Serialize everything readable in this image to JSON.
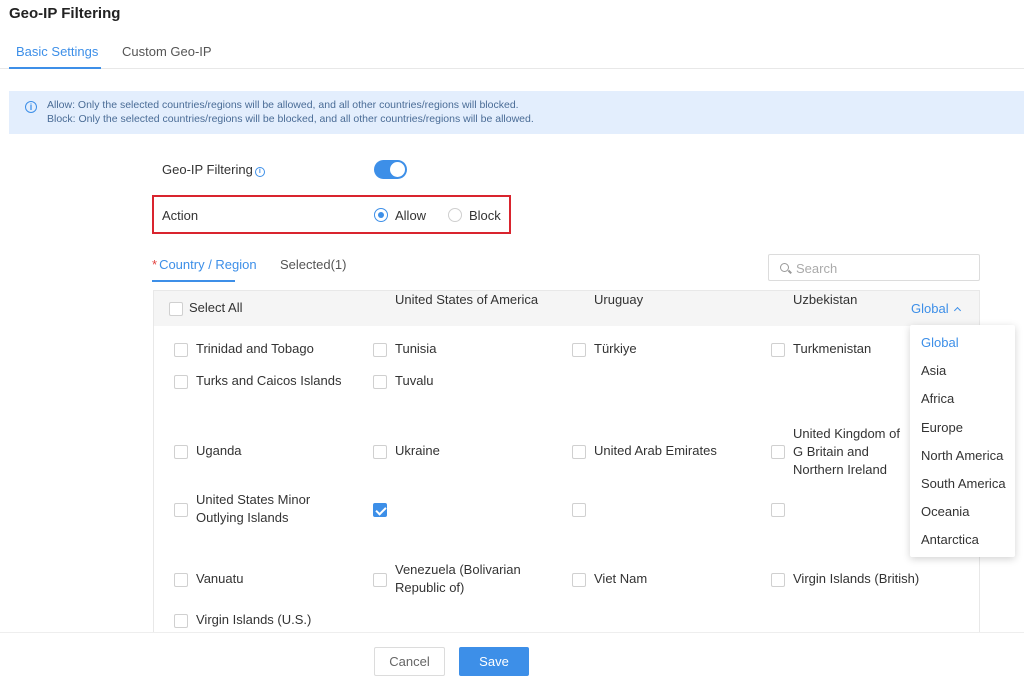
{
  "page": {
    "title": "Geo-IP Filtering"
  },
  "tabs": [
    {
      "label": "Basic Settings"
    },
    {
      "label": "Custom Geo-IP"
    }
  ],
  "info": {
    "line1": "Allow: Only the selected countries/regions will be allowed, and all other countries/regions will blocked.",
    "line2": "Block: Only the selected countries/regions will be blocked, and all other countries/regions will be allowed."
  },
  "form": {
    "geo_label": "Geo-IP Filtering",
    "geo_enabled": true,
    "action_label": "Action",
    "allow_label": "Allow",
    "block_label": "Block",
    "selected_action": "Allow"
  },
  "subtabs": {
    "country": "Country / Region",
    "selected": "Selected(1)"
  },
  "search": {
    "placeholder": "Search"
  },
  "list": {
    "select_all": "Select All",
    "region_filter": "Global",
    "items": [
      {
        "label": "Trinidad and Tobago",
        "checked": false
      },
      {
        "label": "Tunisia",
        "checked": false
      },
      {
        "label": "Türkiye",
        "checked": false
      },
      {
        "label": "Turkmenistan",
        "checked": false
      },
      {
        "label": "Turks and Caicos Islands",
        "checked": false
      },
      {
        "label": "Tuvalu",
        "checked": false
      },
      {
        "label": "Uganda",
        "checked": false
      },
      {
        "label": "Ukraine",
        "checked": false
      },
      {
        "label": "United Arab Emirates",
        "checked": false
      },
      {
        "label": "United Kingdom of G Britain and Northern Ireland",
        "checked": false
      },
      {
        "label": "United States Minor Outlying Islands",
        "checked": false
      },
      {
        "label": "United States of America",
        "checked": true
      },
      {
        "label": "Uruguay",
        "checked": false
      },
      {
        "label": "Uzbekistan",
        "checked": false
      },
      {
        "label": "Vanuatu",
        "checked": false
      },
      {
        "label": "Venezuela (Bolivarian Republic of)",
        "checked": false
      },
      {
        "label": "Viet Nam",
        "checked": false
      },
      {
        "label": "Virgin Islands (British)",
        "checked": false
      },
      {
        "label": "Virgin Islands (U.S.)",
        "checked": false
      }
    ]
  },
  "dropdown": {
    "items": [
      "Global",
      "Asia",
      "Africa",
      "Europe",
      "North America",
      "South America",
      "Oceania",
      "Antarctica"
    ],
    "selected": "Global"
  },
  "footer": {
    "cancel": "Cancel",
    "save": "Save"
  },
  "colors": {
    "accent": "#3d8fe8",
    "highlight_border": "#d9242e",
    "banner_bg": "#e3eefd"
  }
}
